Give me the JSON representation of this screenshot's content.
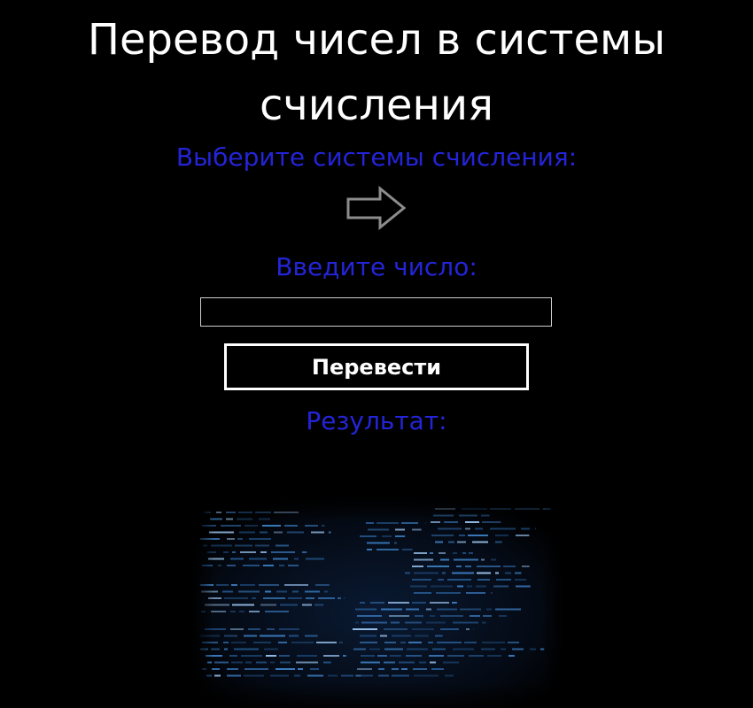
{
  "page": {
    "title": "Перевод чисел в системы счисления"
  },
  "systems_section": {
    "label": "Выберите системы счисления:",
    "arrow_icon": "arrow-right-icon"
  },
  "number_section": {
    "label": "Введите число:",
    "input_value": ""
  },
  "convert_button": {
    "label": "Перевести"
  },
  "result_section": {
    "label": "Результат:"
  },
  "colors": {
    "background": "#000000",
    "title_text": "#ffffff",
    "label_text": "#2424d9",
    "button_border": "#ffffff",
    "code_glow": "#2f6fb8"
  }
}
